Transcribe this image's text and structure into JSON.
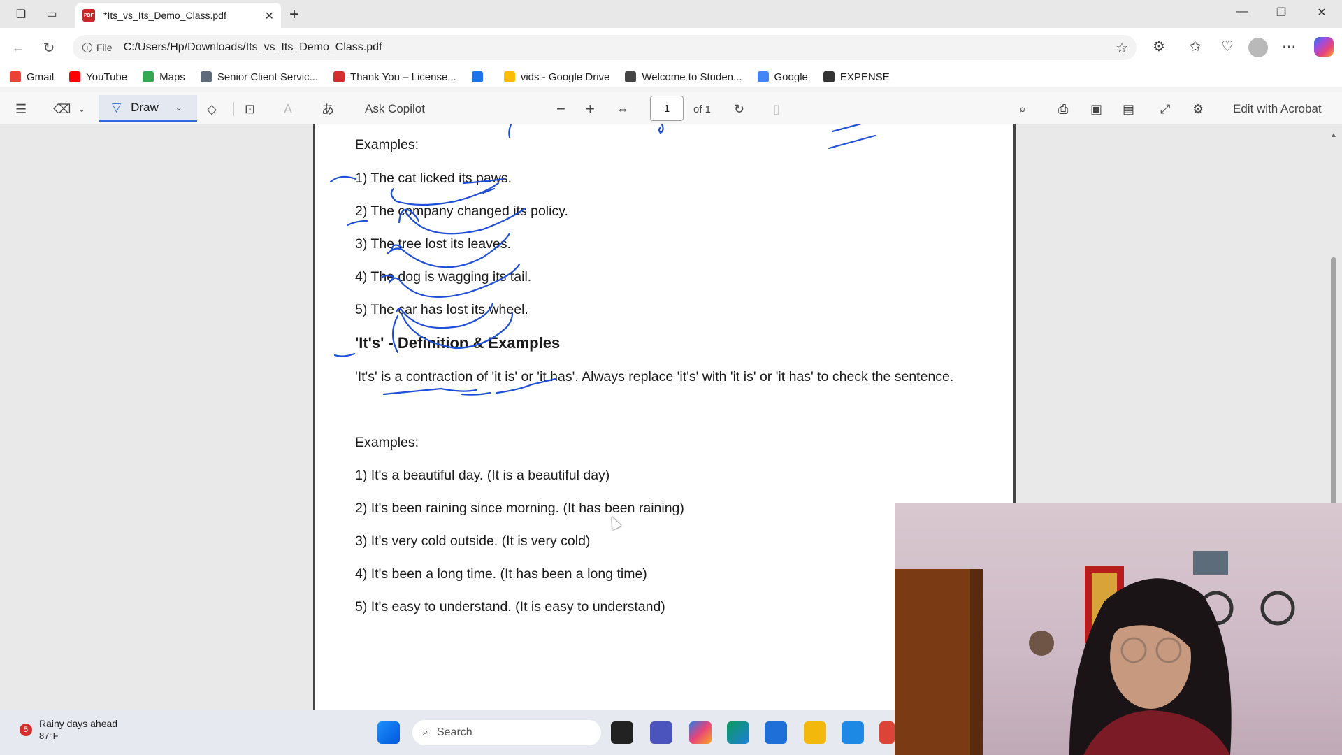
{
  "browser": {
    "tab_title": "*Its_vs_Its_Demo_Class.pdf",
    "tab_icon_label": "PDF",
    "address_label": "File",
    "url": "C:/Users/Hp/Downloads/Its_vs_Its_Demo_Class.pdf"
  },
  "bookmarks": [
    {
      "label": "Gmail",
      "icon": "gmail-icon",
      "color": "#ea4335"
    },
    {
      "label": "YouTube",
      "icon": "youtube-icon",
      "color": "#ff0000"
    },
    {
      "label": "Maps",
      "icon": "maps-icon",
      "color": "#34a853"
    },
    {
      "label": "Senior Client Servic...",
      "icon": "cloud-icon",
      "color": "#5f6b7a"
    },
    {
      "label": "Thank You – License...",
      "icon": "lt-icon",
      "color": "#d32f2f"
    },
    {
      "label": "",
      "icon": "grid-icon",
      "color": "#1a73e8"
    },
    {
      "label": "vids - Google Drive",
      "icon": "drive-icon",
      "color": "#fbbc04"
    },
    {
      "label": "Welcome to Studen...",
      "icon": "globe-icon",
      "color": "#444444"
    },
    {
      "label": "Google",
      "icon": "google-icon",
      "color": "#4285f4"
    },
    {
      "label": "EXPENSE",
      "icon": "diamond-icon",
      "color": "#333333"
    }
  ],
  "pdf_toolbar": {
    "draw_label": "Draw",
    "ask_copilot": "Ask Copilot",
    "page_number": "1",
    "page_of": "of 1",
    "edit_acrobat": "Edit with Acrobat"
  },
  "document": {
    "examples1_heading": "Examples:",
    "its_examples": [
      "1) The cat licked its paws.",
      "2) The company changed its policy.",
      "3) The tree lost its leaves.",
      "4) The dog is wagging its tail.",
      "5) The car has lost its wheel."
    ],
    "section_heading": "'It's' - Definition & Examples",
    "definition": "'It's' is a contraction of 'it is' or 'it has'. Always replace 'it's' with 'it is' or 'it has' to check the sentence.",
    "examples2_heading": "Examples:",
    "itis_examples": [
      "1) It's a beautiful day. (It is a beautiful day)",
      "2) It's been raining since morning. (It has been raining)",
      "3) It's very cold outside. (It is very cold)",
      "4) It's been a long time. (It has been a long time)",
      "5) It's easy to understand. (It is easy to understand)"
    ]
  },
  "taskbar": {
    "weather_badge": "5",
    "weather_text": "Rainy days ahead",
    "temperature": "87°F",
    "search_placeholder": "Search"
  },
  "colors": {
    "ink": "#1f4fd8",
    "accent": "#2f6bd8"
  }
}
